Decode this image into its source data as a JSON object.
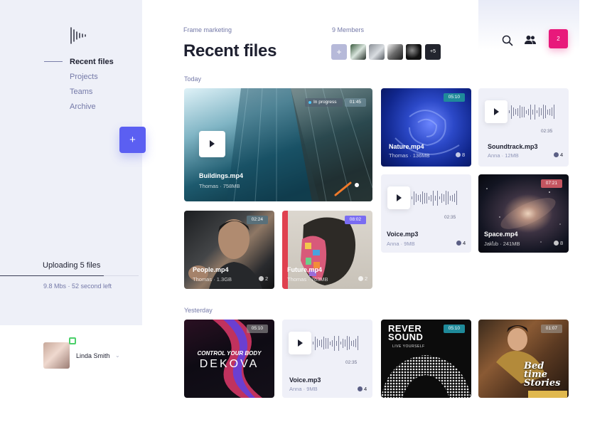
{
  "sidebar": {
    "logo_icon": "soundwave-logo-icon",
    "nav": [
      {
        "label": "Recent files",
        "active": true
      },
      {
        "label": "Projects",
        "active": false
      },
      {
        "label": "Teams",
        "active": false
      },
      {
        "label": "Archive",
        "active": false
      }
    ],
    "add_label": "+",
    "upload": {
      "title": "Uploading 5 files",
      "progress": 0.75,
      "speed": "9.8 Mbs",
      "remaining": "52 second left"
    },
    "user": {
      "name": "Linda Smith",
      "status": "online"
    }
  },
  "header": {
    "breadcrumb": "Frame marketing",
    "title": "Recent files",
    "members_label": "9 Members",
    "members_add": "+",
    "members_more": "+5",
    "notifications": "2",
    "search_icon": "search-icon",
    "team_icon": "users-icon"
  },
  "sections": {
    "today": "Today",
    "yesterday": "Yesterday"
  },
  "files": {
    "buildings": {
      "name": "Buildings.mp4",
      "owner": "Thomas",
      "size": "758MB",
      "duration": "01:45",
      "status": "In progress"
    },
    "nature": {
      "name": "Nature.mp4",
      "owner": "Thomas",
      "size": "136MB",
      "duration": "05:10",
      "comments": "8"
    },
    "soundtrack": {
      "name": "Soundtrack.mp3",
      "owner": "Anna",
      "size": "12MB",
      "duration": "02:35",
      "comments": "4"
    },
    "voice1": {
      "name": "Voice.mp3",
      "owner": "Anna",
      "size": "9MB",
      "duration": "02:35",
      "comments": "4"
    },
    "space": {
      "name": "Space.mp4",
      "owner": "Jakub",
      "size": "241MB",
      "duration": "07:21",
      "comments": "8"
    },
    "people": {
      "name": "People.mp4",
      "owner": "Thomas",
      "size": "1.3GB",
      "duration": "02:24",
      "comments": "2"
    },
    "future": {
      "name": "Future.mp4",
      "owner": "Thomas",
      "size": "763MB",
      "duration": "08:02",
      "comments": "2"
    },
    "dekova": {
      "duration": "05:10",
      "art_title": "CONTROL YOUR BODY",
      "art_sub": "DEKOVA"
    },
    "voice2": {
      "name": "Voice.mp3",
      "owner": "Anna",
      "size": "9MB",
      "duration": "02:35",
      "comments": "4"
    },
    "reverse": {
      "duration": "05:10",
      "art_title": "REVER SOUND",
      "art_sub": "LIVE YOURSELF"
    },
    "bedtime": {
      "duration": "01:07",
      "art_title": "Bed time Stories"
    }
  },
  "colors": {
    "accent": "#5b5ff2",
    "notification": "#e8197b",
    "duration_teal": "#1f8a9a",
    "duration_purple": "#7a6cf2",
    "duration_red": "#c45560"
  }
}
